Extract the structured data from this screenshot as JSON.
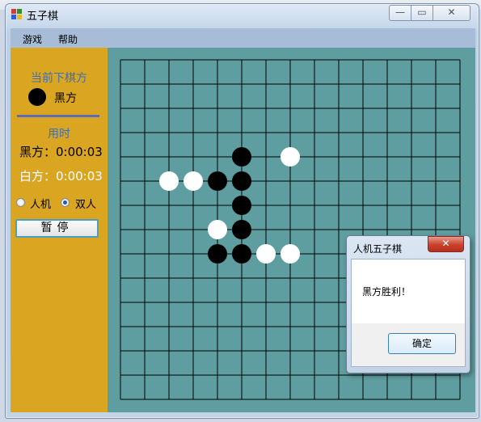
{
  "window": {
    "title": "五子棋",
    "controls": {
      "minimize": "—",
      "maximize": "▭",
      "close": "✕"
    }
  },
  "menu": {
    "items": [
      "游戏",
      "帮助"
    ]
  },
  "side_panel": {
    "current_player_label": "当前下棋方",
    "current_player": "黑方",
    "current_stone_color": "#000000",
    "time_label": "用时",
    "black_time": "黑方：0:00:03",
    "white_time": "白方：0:00:03",
    "mode_options": [
      {
        "label": "人机",
        "checked": false
      },
      {
        "label": "双人",
        "checked": true
      }
    ],
    "pause_button": "暂停"
  },
  "board": {
    "size": 15,
    "board_color": "#5f9ea0",
    "line_color": "#000000",
    "stones": [
      {
        "col": 5,
        "row": 4,
        "color": "black"
      },
      {
        "col": 7,
        "row": 4,
        "color": "white"
      },
      {
        "col": 4,
        "row": 5,
        "color": "black"
      },
      {
        "col": 5,
        "row": 5,
        "color": "black"
      },
      {
        "col": 2,
        "row": 5,
        "color": "white"
      },
      {
        "col": 3,
        "row": 5,
        "color": "white"
      },
      {
        "col": 5,
        "row": 6,
        "color": "black"
      },
      {
        "col": 5,
        "row": 7,
        "color": "black"
      },
      {
        "col": 4,
        "row": 7,
        "color": "white"
      },
      {
        "col": 4,
        "row": 8,
        "color": "black"
      },
      {
        "col": 5,
        "row": 8,
        "color": "black"
      },
      {
        "col": 6,
        "row": 8,
        "color": "white"
      },
      {
        "col": 7,
        "row": 8,
        "color": "white"
      }
    ]
  },
  "dialog": {
    "title": "人机五子棋",
    "close": "✕",
    "message": "黑方胜利！",
    "ok_button": "确定"
  }
}
